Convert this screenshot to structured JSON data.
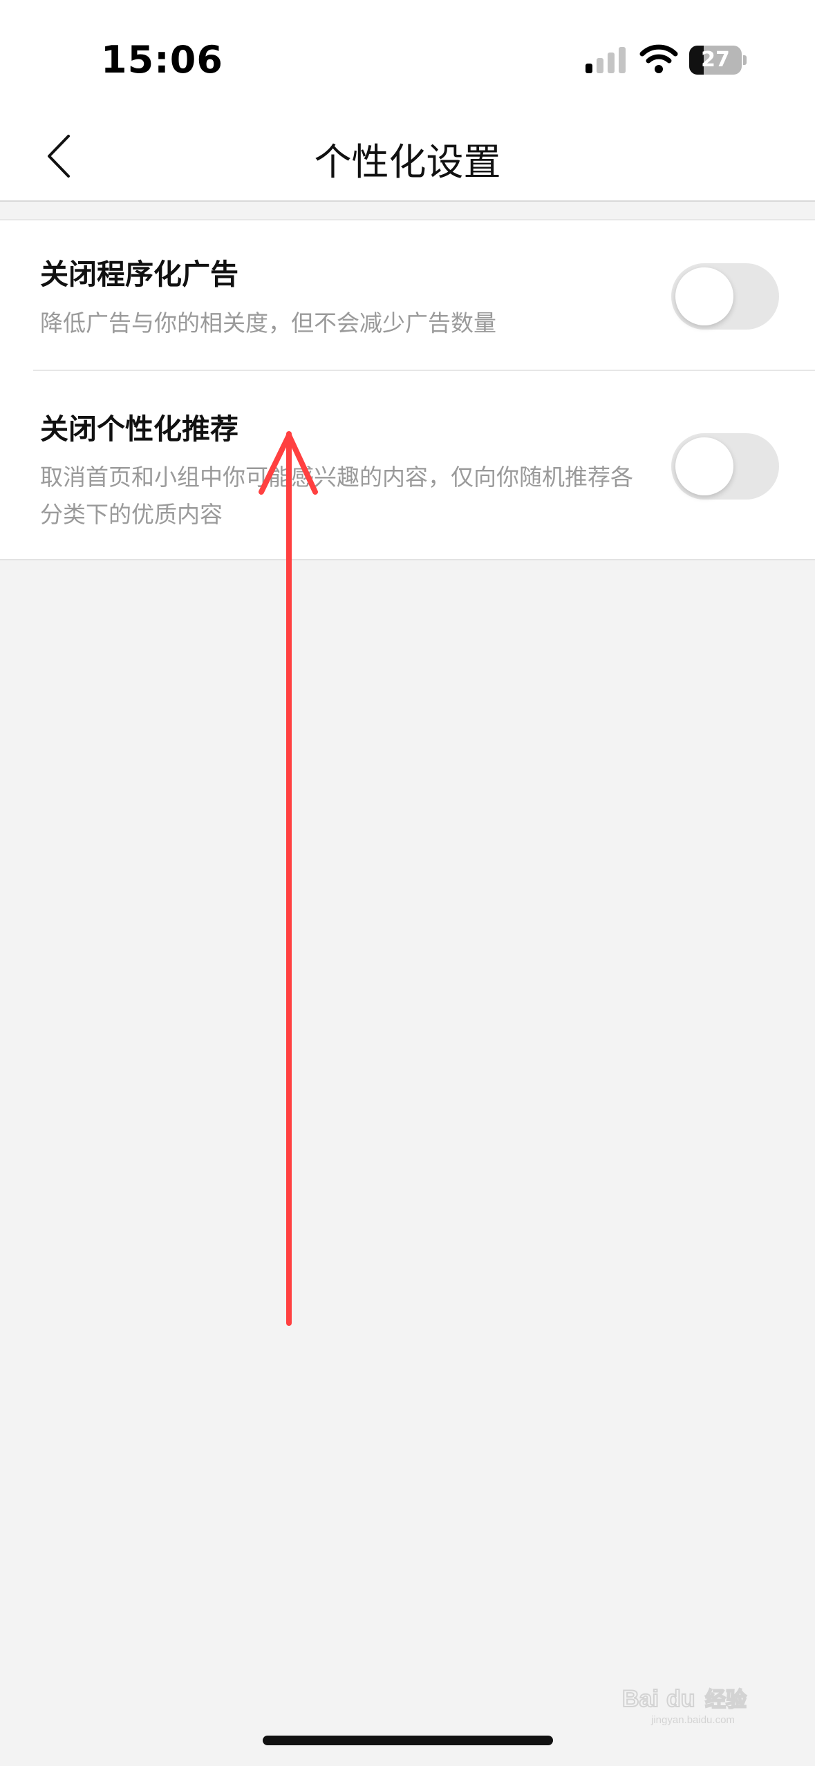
{
  "status_bar": {
    "time": "15:06",
    "battery_level": "27",
    "battery_fraction": 0.27,
    "icons": [
      "signal-icon",
      "wifi-icon",
      "battery-icon"
    ]
  },
  "nav": {
    "title": "个性化设置",
    "back_icon": "chevron-left-icon"
  },
  "settings": [
    {
      "title": "关闭程序化广告",
      "description": "降低广告与你的相关度，但不会减少广告数量",
      "enabled": false
    },
    {
      "title": "关闭个性化推荐",
      "description": "取消首页和小组中你可能感兴趣的内容，仅向你随机推荐各分类下的优质内容",
      "enabled": false
    }
  ],
  "colors": {
    "background": "#f3f3f3",
    "surface": "#ffffff",
    "toggle_off": "#e6e6e6",
    "annotation": "#ff4040",
    "secondary_text": "#9a9a9a"
  },
  "watermark": {
    "text": "Bai du 经验",
    "subtext": "jingyan.baidu.com"
  }
}
